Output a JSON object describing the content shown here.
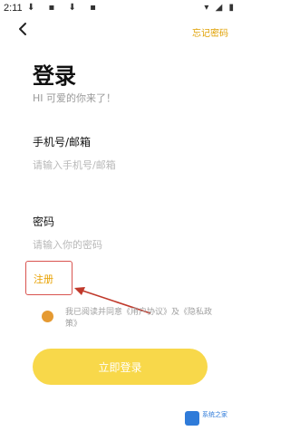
{
  "status_bar": {
    "time": "2:11",
    "left_icons": "⬇ ▪ ⬇ ▪",
    "right_icons": "▾ ◢ ▮"
  },
  "header": {
    "back_icon": "chevron-left-icon",
    "forgot_password": "忘记密码"
  },
  "main": {
    "title": "登录",
    "subtitle": "HI 可爱的你来了！",
    "phone_label": "手机号/邮箱",
    "phone_placeholder": "请输入手机号/邮箱",
    "password_label": "密码",
    "password_placeholder": "请输入你的密码",
    "register_link": "注册",
    "consent_text": "我已阅读并同意《用户协议》及《隐私政策》",
    "login_button": "立即登录"
  },
  "watermark": {
    "text": "系统之家"
  },
  "colors": {
    "accent": "#f8d84a",
    "link": "#e0a000",
    "annotation": "#d9534f",
    "checkbox": "#e59a32"
  }
}
